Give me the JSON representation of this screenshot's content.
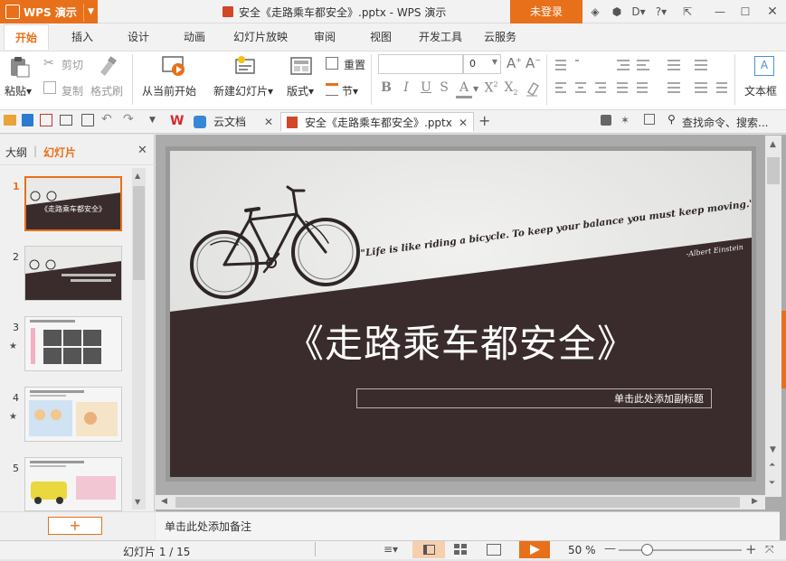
{
  "titlebar": {
    "app_name": "WPS 演示",
    "doc_title": "安全《走路乘车都安全》.pptx - WPS 演示",
    "login_label": "未登录"
  },
  "menu": {
    "tabs": [
      "开始",
      "插入",
      "设计",
      "动画",
      "幻灯片放映",
      "审阅",
      "视图",
      "开发工具",
      "云服务"
    ]
  },
  "ribbon": {
    "paste": "粘贴",
    "cut": "剪切",
    "copy": "复制",
    "format_painter": "格式刷",
    "from_current": "从当前开始",
    "new_slide": "新建幻灯片",
    "layout": "版式",
    "reset": "重置",
    "section": "节",
    "font_size": "0",
    "textbox": "文本框"
  },
  "tabsbar": {
    "cloud_tab": "云文档",
    "doc_tab": "安全《走路乘车都安全》.pptx",
    "search_placeholder": "查找命令、搜索..."
  },
  "leftpanel": {
    "outline_tab": "大纲",
    "slides_tab": "幻灯片",
    "thumbs": [
      {
        "num": "1",
        "star": false,
        "title": "《走路乘车都安全》"
      },
      {
        "num": "2",
        "star": false
      },
      {
        "num": "3",
        "star": true
      },
      {
        "num": "4",
        "star": true
      },
      {
        "num": "5",
        "star": false
      }
    ],
    "star_glyph": "★"
  },
  "slide": {
    "quote": "\"Life is like riding a bicycle. To keep your balance you must keep moving.\"",
    "author": "-Albert Einstein",
    "title": "《走路乘车都安全》",
    "subtitle_placeholder": "单击此处添加副标题"
  },
  "notes_placeholder": "单击此处添加备注",
  "status": {
    "slide_counter": "幻灯片 1 / 15",
    "zoom": "50 %"
  },
  "colors": {
    "accent": "#e8701a",
    "slide_dark": "#3a2c2c",
    "slide_light": "#e9e9e7"
  }
}
